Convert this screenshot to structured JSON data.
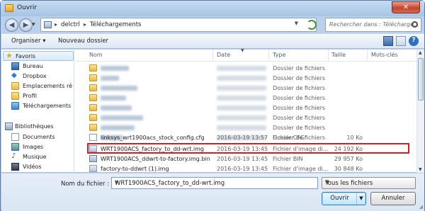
{
  "window": {
    "title": "Ouvrir",
    "close_glyph": "✕"
  },
  "navbar": {
    "back_glyph": "◀",
    "forward_glyph": "▶",
    "dropdown_glyph": "▼",
    "breadcrumb": [
      "delctrl",
      "Téléchargements"
    ],
    "separator": "▸",
    "search_placeholder": "Rechercher dans : Télécharge..."
  },
  "toolbar": {
    "organize_label": "Organiser",
    "new_folder_label": "Nouveau dossier",
    "dropdown_glyph": "▾",
    "help_glyph": "?"
  },
  "sidebar": {
    "favorites_label": "Favoris",
    "favorites": [
      {
        "label": "Bureau",
        "icon": "desktop-icon"
      },
      {
        "label": "Dropbox",
        "icon": "dropbox-icon"
      },
      {
        "label": "Emplacements ré",
        "icon": "recent-places-icon"
      },
      {
        "label": "Profil",
        "icon": "user-folder-icon"
      },
      {
        "label": "Téléchargements",
        "icon": "downloads-icon"
      }
    ],
    "libraries_label": "Bibliothèques",
    "libraries": [
      {
        "label": "Documents",
        "icon": "documents-icon"
      },
      {
        "label": "Images",
        "icon": "images-icon"
      },
      {
        "label": "Musique",
        "icon": "music-icon"
      },
      {
        "label": "Vidéos",
        "icon": "videos-icon"
      }
    ]
  },
  "columns": {
    "name": "Nom",
    "date": "Date",
    "type": "Type",
    "size": "Taille",
    "tags": "Mots-clés"
  },
  "folder_rows": [
    {
      "type": "Dossier de fichiers"
    },
    {
      "type": "Dossier de fichiers"
    },
    {
      "type": "Dossier de fichiers"
    },
    {
      "type": "Dossier de fichiers"
    },
    {
      "type": "Dossier de fichiers"
    },
    {
      "type": "Dossier de fichiers"
    },
    {
      "type": "Dossier de fichiers"
    },
    {
      "type": "Dossier de fichiers"
    }
  ],
  "file_rows": [
    {
      "name": "linksys_wrt1900acs_stock_config.cfg",
      "date": "2016-03-19 13:57",
      "type": "Fichier CFG",
      "size": "10 Ko",
      "icon": "file-icon"
    },
    {
      "name": "WRT1900ACS_factory_to_dd-wrt.img",
      "date": "2016-03-19 13:45",
      "type": "Fichier d'image di...",
      "size": "24 192 Ko",
      "icon": "disk-image-icon"
    },
    {
      "name": "WRT1900ACS_ddwrt-to-factory.img.bin",
      "date": "2016-03-19 13:45",
      "type": "Fichier BIN",
      "size": "29 957 Ko",
      "icon": "bin-file-icon"
    },
    {
      "name": "factory-to-ddwrt (1).img",
      "date": "2016-03-19 13:45",
      "type": "Fichier d'image di...",
      "size": "30 848 Ko",
      "icon": "disk-image-icon"
    }
  ],
  "bottom": {
    "filename_label": "Nom du fichier :",
    "filename_value": "WRT1900ACS_factory_to_dd-wrt.img",
    "filetype_value": "Tous les fichiers",
    "open_label": "Ouvrir",
    "cancel_label": "Annuler",
    "dropdown_glyph": "▼"
  },
  "colors": {
    "highlight": "#d21f24",
    "selection": "#d9e9fb"
  }
}
